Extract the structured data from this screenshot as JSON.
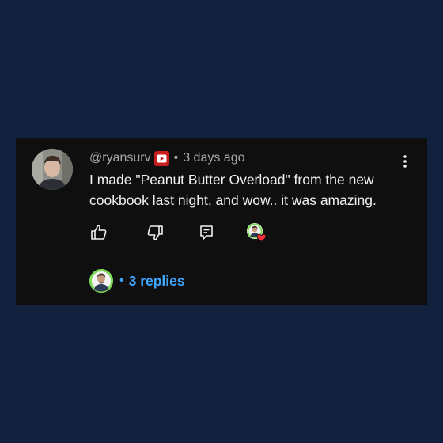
{
  "comment": {
    "username": "@ryansurv",
    "separator": "•",
    "timestamp": "3 days ago",
    "text": "I made \"Peanut Butter Overload\" from the new cookbook last night, and wow.. it was amazing.",
    "badge_icon": "member-badge-icon",
    "more_icon": "more-vert-icon"
  },
  "actions": {
    "like_icon": "thumbs-up-icon",
    "dislike_icon": "thumbs-down-icon",
    "reply_icon": "reply-icon",
    "creator_heart_icon": "creator-heart-icon"
  },
  "replies": {
    "dot": "•",
    "label": "3 replies"
  },
  "colors": {
    "background": "#12213d",
    "card": "#0f0f0f",
    "text": "#f1f1f1",
    "muted": "#aaaaaa",
    "link": "#3ea6ff",
    "badge_red": "#c81e1e",
    "heart_red": "#ff2d3c",
    "creator_green": "#7ed957"
  }
}
